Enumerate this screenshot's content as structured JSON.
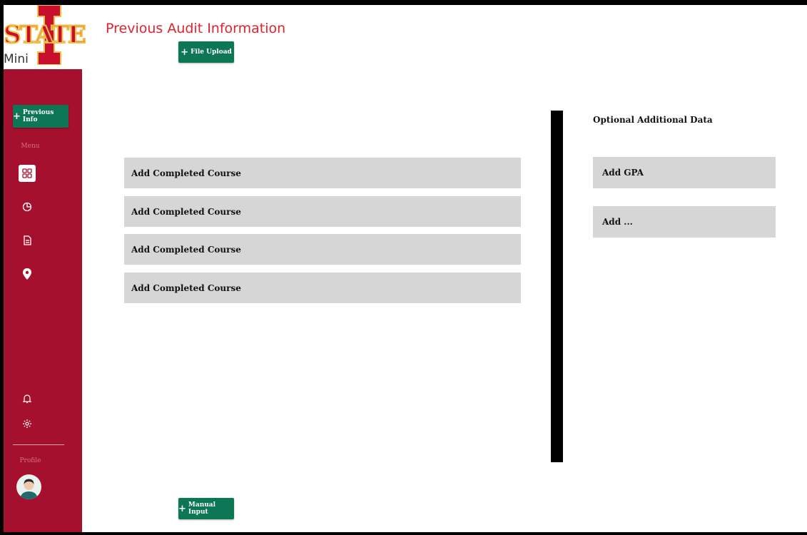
{
  "brand": {
    "logo_text": "STATE",
    "logo_sub": "Mini"
  },
  "sidebar": {
    "previous_info_label": "Previous Info",
    "menu_label": "Menu",
    "profile_label": "Profile"
  },
  "header": {
    "title": "Previous Audit Information"
  },
  "actions": {
    "file_upload_label": "File Upload",
    "manual_input_label": "Manual Input"
  },
  "courses": [
    {
      "label": "Add Completed Course"
    },
    {
      "label": "Add Completed Course"
    },
    {
      "label": "Add Completed Course"
    },
    {
      "label": "Add Completed Course"
    }
  ],
  "optional": {
    "title": "Optional Additional Data",
    "items": [
      {
        "label": "Add GPA"
      },
      {
        "label": "Add ..."
      }
    ]
  },
  "colors": {
    "sidebar": "#a6102f",
    "accent_green": "#0c7655",
    "title_red": "#e0242f",
    "row_gray": "#d6d6d6"
  }
}
